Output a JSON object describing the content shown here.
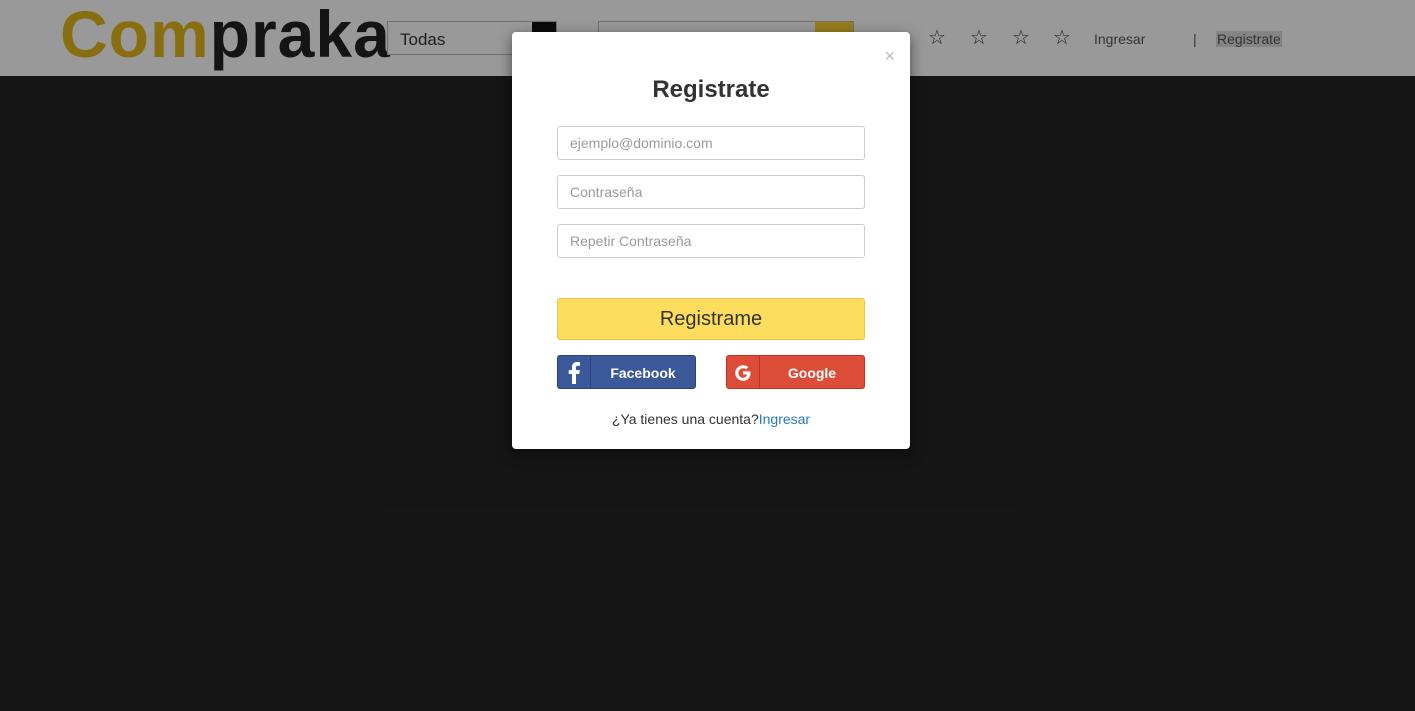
{
  "header": {
    "logo_part1": "Com",
    "logo_part2": "praka",
    "category_value": "Todas",
    "stars": [
      "☆",
      "☆",
      "☆",
      "☆"
    ],
    "login_link": "Ingresar",
    "separator": "|",
    "register_link": "Registrate"
  },
  "modal": {
    "close_label": "×",
    "title": "Registrate",
    "email_placeholder": "ejemplo@dominio.com",
    "password_placeholder": "Contraseña",
    "repeat_password_placeholder": "Repetir Contraseña",
    "submit_label": "Registrame",
    "facebook_label": "Facebook",
    "google_label": "Google",
    "have_account_text": "¿Ya tienes una cuenta?",
    "login_link": "Ingresar"
  },
  "colors": {
    "accent_yellow": "#ffdd5c",
    "facebook_blue": "#3b5998",
    "google_red": "#dd4b39",
    "link_blue": "#2a7ab9"
  },
  "icons": {
    "facebook": "facebook-icon",
    "google": "google-icon",
    "close": "close-icon",
    "star": "star-icon"
  }
}
